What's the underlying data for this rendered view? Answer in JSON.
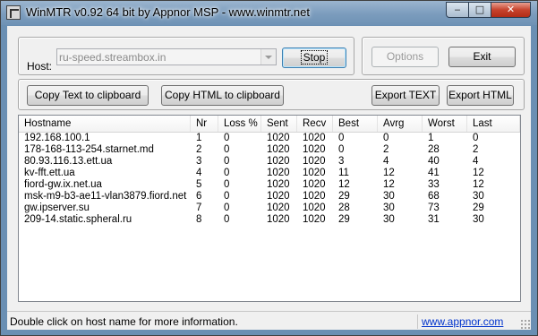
{
  "window": {
    "title": "WinMTR v0.92 64 bit by Appnor MSP - www.winmtr.net"
  },
  "title_buttons": {
    "minimize": "‒",
    "maximize": "□",
    "close": "✕"
  },
  "host": {
    "label": "Host:",
    "value": "ru-speed.streambox.in"
  },
  "buttons": {
    "stop": "Stop",
    "options": "Options",
    "exit": "Exit",
    "copy_text": "Copy Text to clipboard",
    "copy_html": "Copy HTML to clipboard",
    "export_text": "Export TEXT",
    "export_html": "Export HTML"
  },
  "table": {
    "columns": [
      "Hostname",
      "Nr",
      "Loss %",
      "Sent",
      "Recv",
      "Best",
      "Avrg",
      "Worst",
      "Last"
    ],
    "rows": [
      [
        "192.168.100.1",
        "1",
        "0",
        "1020",
        "1020",
        "0",
        "0",
        "1",
        "0"
      ],
      [
        "178-168-113-254.starnet.md",
        "2",
        "0",
        "1020",
        "1020",
        "0",
        "2",
        "28",
        "2"
      ],
      [
        "80.93.116.13.ett.ua",
        "3",
        "0",
        "1020",
        "1020",
        "3",
        "4",
        "40",
        "4"
      ],
      [
        "kv-fft.ett.ua",
        "4",
        "0",
        "1020",
        "1020",
        "11",
        "12",
        "41",
        "12"
      ],
      [
        "fiord-gw.ix.net.ua",
        "5",
        "0",
        "1020",
        "1020",
        "12",
        "12",
        "33",
        "12"
      ],
      [
        "msk-m9-b3-ae11-vlan3879.fiord.net",
        "6",
        "0",
        "1020",
        "1020",
        "29",
        "30",
        "68",
        "30"
      ],
      [
        "gw.ipserver.su",
        "7",
        "0",
        "1020",
        "1020",
        "28",
        "30",
        "73",
        "29"
      ],
      [
        "209-14.static.spheral.ru",
        "8",
        "0",
        "1020",
        "1020",
        "29",
        "30",
        "31",
        "30"
      ]
    ]
  },
  "status": {
    "message": "Double click on host name for more information.",
    "link": "www.appnor.com"
  }
}
